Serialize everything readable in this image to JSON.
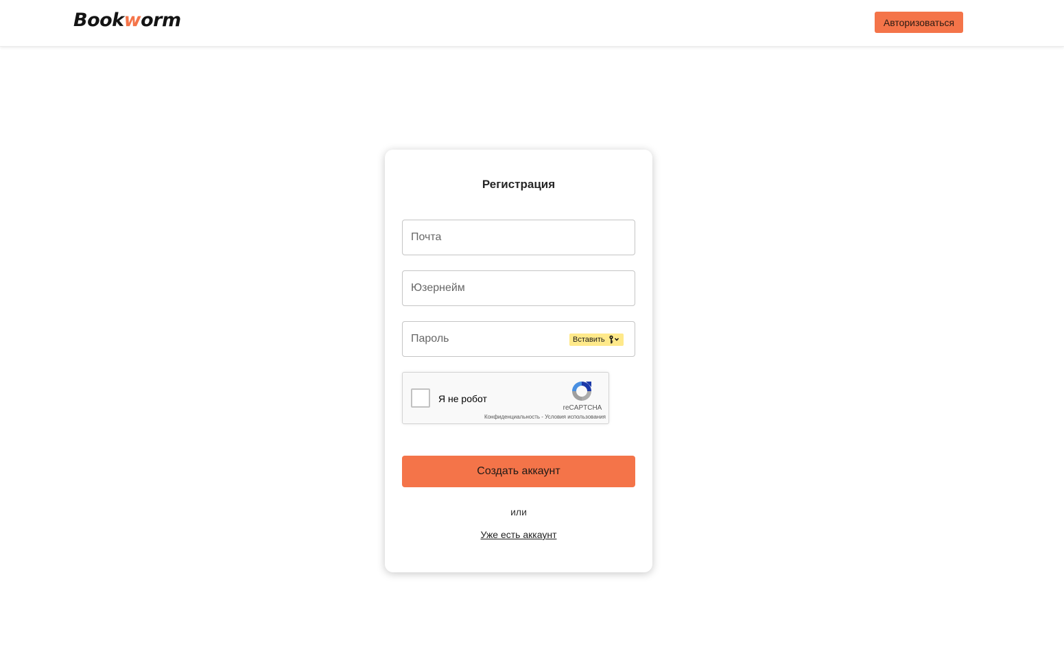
{
  "header": {
    "logo_prefix": "Book",
    "logo_accent": "w",
    "logo_suffix": "orm",
    "login_label": "Авторизоваться"
  },
  "form": {
    "title": "Регистрация",
    "email_placeholder": "Почта",
    "username_placeholder": "Юзернейм",
    "password_placeholder": "Пароль",
    "paste_label": "Вставить",
    "captcha": {
      "label": "Я не робот",
      "brand": "reCAPTCHA",
      "links": "Конфиденциальность - Условия использования"
    },
    "submit_label": "Создать аккаунт",
    "or_label": "или",
    "have_account_label": "Уже есть аккаунт"
  },
  "colors": {
    "accent": "#f47449",
    "paste_chip": "#ffe98a"
  },
  "icons": [
    "key-icon",
    "chevron-down-icon",
    "recaptcha-logo-icon"
  ]
}
